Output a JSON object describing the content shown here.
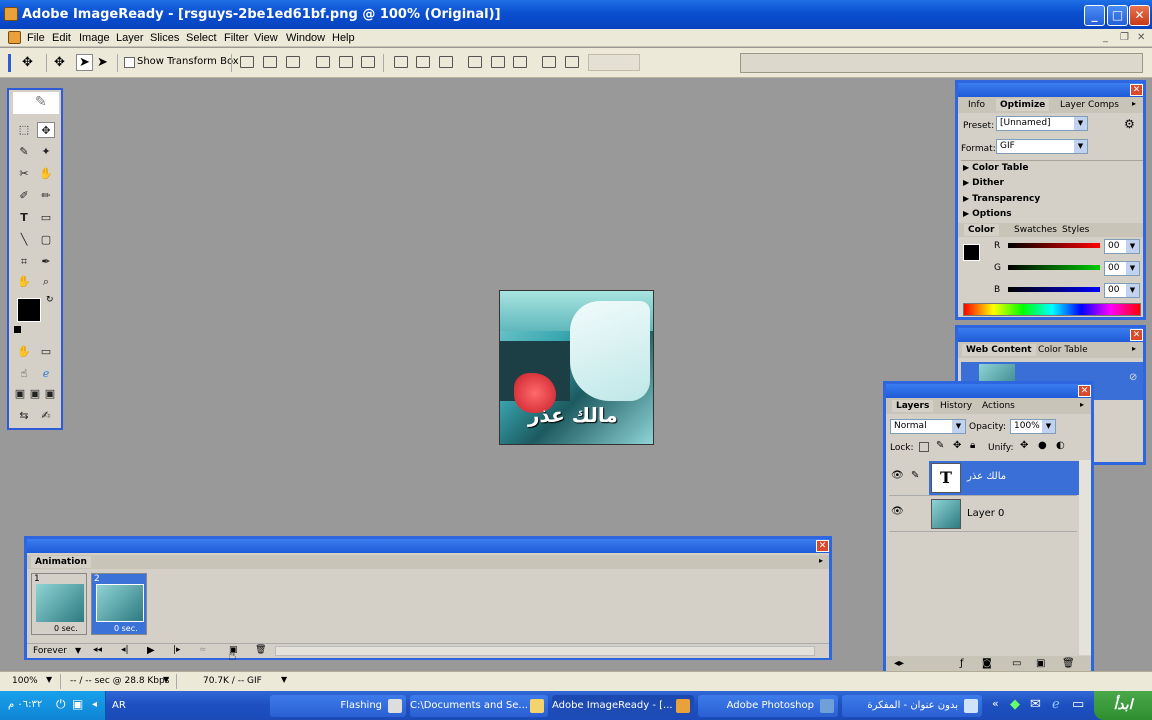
{
  "window": {
    "title": "Adobe ImageReady - [rsguys-2be1ed61bf.png @ 100% (Original)]"
  },
  "menu": [
    "File",
    "Edit",
    "Image",
    "Layer",
    "Slices",
    "Select",
    "Filter",
    "View",
    "Window",
    "Help"
  ],
  "options_bar": {
    "show_transform_box": "Show Transform Box",
    "show_transform_checked": false
  },
  "canvas": {
    "overlay_text": "مالك عذر"
  },
  "optimize_palette": {
    "tabs": [
      "Info",
      "Optimize",
      "Layer Comps"
    ],
    "active_tab": "Optimize",
    "preset_label": "Preset:",
    "preset_value": "[Unnamed]",
    "format_label": "Format:",
    "format_value": "GIF",
    "sections": [
      "Color Table",
      "Dither",
      "Transparency",
      "Options"
    ]
  },
  "color_palette": {
    "tabs": [
      "Color",
      "Swatches",
      "Styles"
    ],
    "active_tab": "Color",
    "channels": [
      {
        "label": "R",
        "value": "00"
      },
      {
        "label": "G",
        "value": "00"
      },
      {
        "label": "B",
        "value": "00"
      }
    ]
  },
  "web_content_palette": {
    "tabs": [
      "Web Content",
      "Color Table"
    ],
    "active_tab": "Web Content"
  },
  "layers_palette": {
    "tabs": [
      "Layers",
      "History",
      "Actions"
    ],
    "active_tab": "Layers",
    "blend_mode": "Normal",
    "opacity_label": "Opacity:",
    "opacity_value": "100%",
    "lock_label": "Lock:",
    "unify_label": "Unify:",
    "layers": [
      {
        "name": "مالك عذر",
        "thumb": "T",
        "selected": true
      },
      {
        "name": "Layer 0",
        "thumb": "",
        "selected": false
      }
    ]
  },
  "animation_palette": {
    "tab": "Animation",
    "frames": [
      {
        "number": "1",
        "delay": "0 sec.",
        "selected": false
      },
      {
        "number": "2",
        "delay": "0 sec.",
        "selected": true
      }
    ],
    "loop": "Forever"
  },
  "status_bar": {
    "zoom": "100%",
    "download_time": "-- / -- sec @ 28.8 Kbps",
    "size_info": "70.7K / -- GIF"
  },
  "taskbar": {
    "start_label": "ابدأ",
    "language": "AR",
    "clock": "٠٦:٣٢ م",
    "tasks": [
      {
        "label": "Flashing",
        "active": false
      },
      {
        "label": "C:\\Documents and Se...",
        "active": false
      },
      {
        "label": "Adobe ImageReady - [...",
        "active": true
      },
      {
        "label": "Adobe Photoshop",
        "active": false
      },
      {
        "label": "بدون عنوان - المفكرة",
        "active": false
      }
    ]
  }
}
